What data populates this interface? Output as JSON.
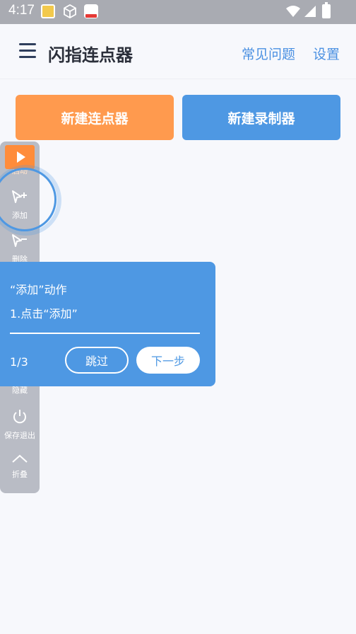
{
  "status_bar": {
    "time": "4:17"
  },
  "app_bar": {
    "title": "闪指连点器",
    "faq_label": "常见问题",
    "settings_label": "设置"
  },
  "actions": {
    "new_clicker": "新建连点器",
    "new_recorder": "新建录制器"
  },
  "toolbar": {
    "start": "启动",
    "add": "添加",
    "remove": "删除",
    "hide": "隐藏",
    "save_exit": "保存退出",
    "fold": "折叠"
  },
  "guide": {
    "title": "“添加”动作",
    "step": "1.点击“添加”",
    "counter": "1/3",
    "skip": "跳过",
    "next": "下一步"
  },
  "colors": {
    "accent_blue": "#4e98e3",
    "accent_orange": "#ff9a4e"
  }
}
